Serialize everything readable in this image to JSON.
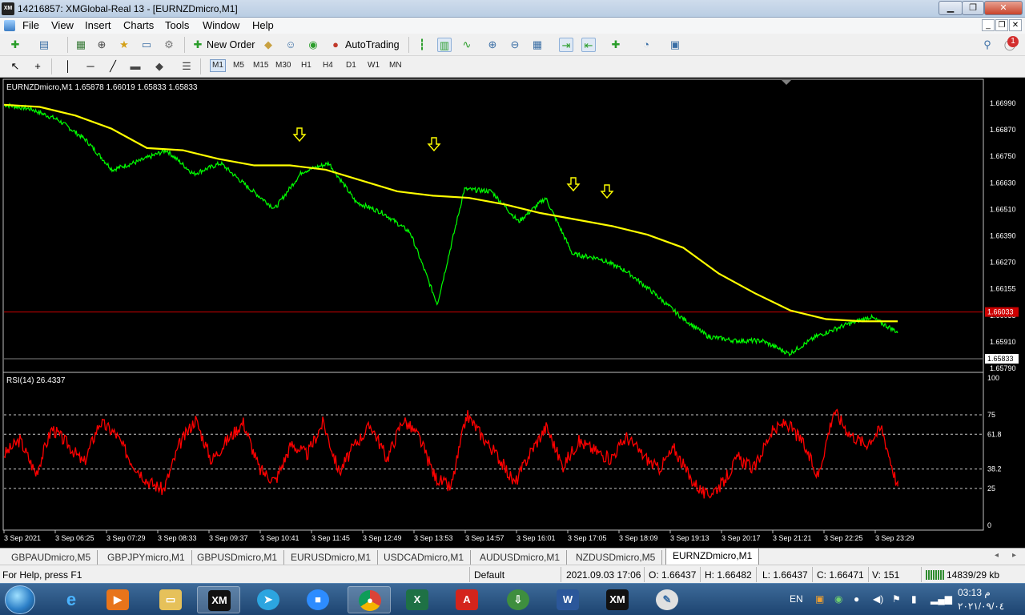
{
  "window": {
    "title": "14216857: XMGlobal-Real 13 - [EURNZDmicro,M1]",
    "app_icon": "XM",
    "controls": [
      "minimize-icon",
      "restore-icon",
      "close-icon"
    ]
  },
  "menu": [
    "File",
    "View",
    "Insert",
    "Charts",
    "Tools",
    "Window",
    "Help"
  ],
  "toolbar": {
    "new_order": "New Order",
    "auto_trading": "AutoTrading",
    "notification_count": "1",
    "timeframes": [
      "M1",
      "M5",
      "M15",
      "M30",
      "H1",
      "H4",
      "D1",
      "W1",
      "MN"
    ],
    "active_timeframe": "M1"
  },
  "chart": {
    "header": "EURNZDmicro,M1  1.65878 1.66019 1.65833 1.65833",
    "price_labels": [
      "1.66990",
      "1.66870",
      "1.66750",
      "1.66630",
      "1.66510",
      "1.66390",
      "1.66270",
      "1.66155",
      "1.66035",
      "1.65910",
      "1.65790"
    ],
    "bid_label": "1.65833",
    "hline_label": "1.66033",
    "rsi_header": "RSI(14) 26.4337",
    "rsi_labels": [
      "100",
      "75",
      "61.8",
      "38.2",
      "25",
      "0"
    ],
    "time_labels": [
      "3 Sep 2021",
      "3 Sep 06:25",
      "3 Sep 07:29",
      "3 Sep 08:33",
      "3 Sep 09:37",
      "3 Sep 10:41",
      "3 Sep 11:45",
      "3 Sep 12:49",
      "3 Sep 13:53",
      "3 Sep 14:57",
      "3 Sep 16:01",
      "3 Sep 17:05",
      "3 Sep 18:09",
      "3 Sep 19:13",
      "3 Sep 20:17",
      "3 Sep 21:21",
      "3 Sep 22:25",
      "3 Sep 23:29"
    ],
    "colors": {
      "price": "#00ff00",
      "ma": "#ffff00",
      "rsi": "#ff0000",
      "hline": "#cc0000",
      "arrows": "#ffff00"
    },
    "arrow_count": 5
  },
  "chart_data": [
    {
      "type": "line",
      "series": [
        {
          "name": "EURNZDmicro,M1",
          "y": [
            1.6699,
            1.6697,
            1.6692,
            1.6683,
            1.6669,
            1.6673,
            1.6678,
            1.6667,
            1.6672,
            1.6661,
            1.6651,
            1.6668,
            1.6672,
            1.6654,
            1.6649,
            1.664,
            1.6607,
            1.666,
            1.6659,
            1.6645,
            1.6656,
            1.663,
            1.6628,
            1.6622,
            1.6612,
            1.6601,
            1.6592,
            1.659,
            1.659,
            1.6584,
            1.6592,
            1.6597,
            1.6601,
            1.6594
          ]
        },
        {
          "name": "MA",
          "y": [
            1.6699,
            1.6698,
            1.6694,
            1.6688,
            1.6679,
            1.6678,
            1.6674,
            1.6671,
            1.6671,
            1.6669,
            1.6664,
            1.6659,
            1.6657,
            1.6656,
            1.6653,
            1.6649,
            1.6646,
            1.6643,
            1.6639,
            1.6633,
            1.6621,
            1.6612,
            1.6604,
            1.66,
            1.6599,
            1.6599
          ]
        }
      ],
      "ylim": [
        1.6578,
        1.6703
      ],
      "hline": 1.66033
    },
    {
      "type": "line",
      "series": [
        {
          "name": "RSI(14)",
          "y": [
            48,
            58,
            35,
            66,
            55,
            42,
            70,
            62,
            43,
            30,
            24,
            55,
            72,
            44,
            58,
            70,
            38,
            30,
            55,
            48,
            70,
            36,
            55,
            68,
            45,
            72,
            60,
            33,
            25,
            75,
            60,
            46,
            28,
            50,
            67,
            40,
            57,
            51,
            45,
            60,
            48,
            38,
            52,
            32,
            20,
            28,
            46,
            38,
            62,
            70,
            57,
            33,
            78,
            62,
            55,
            66,
            26
          ]
        }
      ],
      "ylim": [
        0,
        100
      ],
      "levels": [
        75,
        61.8,
        38.2,
        25
      ]
    }
  ],
  "tabs": [
    "GBPAUDmicro,M5",
    "GBPJPYmicro,M1",
    "GBPUSDmicro,M1",
    "EURUSDmicro,M1",
    "USDCADmicro,M1",
    "AUDUSDmicro,M1",
    "NZDUSDmicro,M5",
    "EURNZDmicro,M1"
  ],
  "active_tab": "EURNZDmicro,M1",
  "status": {
    "help": "For Help, press F1",
    "profile": "Default",
    "datetime": "2021.09.03 17:06",
    "open": "O: 1.66437",
    "high": "H: 1.66482",
    "low": "L: 1.66437",
    "close": "C: 1.66471",
    "volume": "V: 151",
    "traffic": "14839/29 kb"
  },
  "taskbar": {
    "apps": [
      "ie-icon",
      "media-player-icon",
      "explorer-icon",
      "xm-icon",
      "telegram-icon",
      "zoom-icon",
      "chrome-icon",
      "excel-icon",
      "acrobat-icon",
      "download-manager-icon",
      "word-icon",
      "xm-icon",
      "paint-icon"
    ],
    "lang": "EN",
    "time": "03:13 م",
    "date": "٢٠٢١/٠٩/٠٤"
  }
}
